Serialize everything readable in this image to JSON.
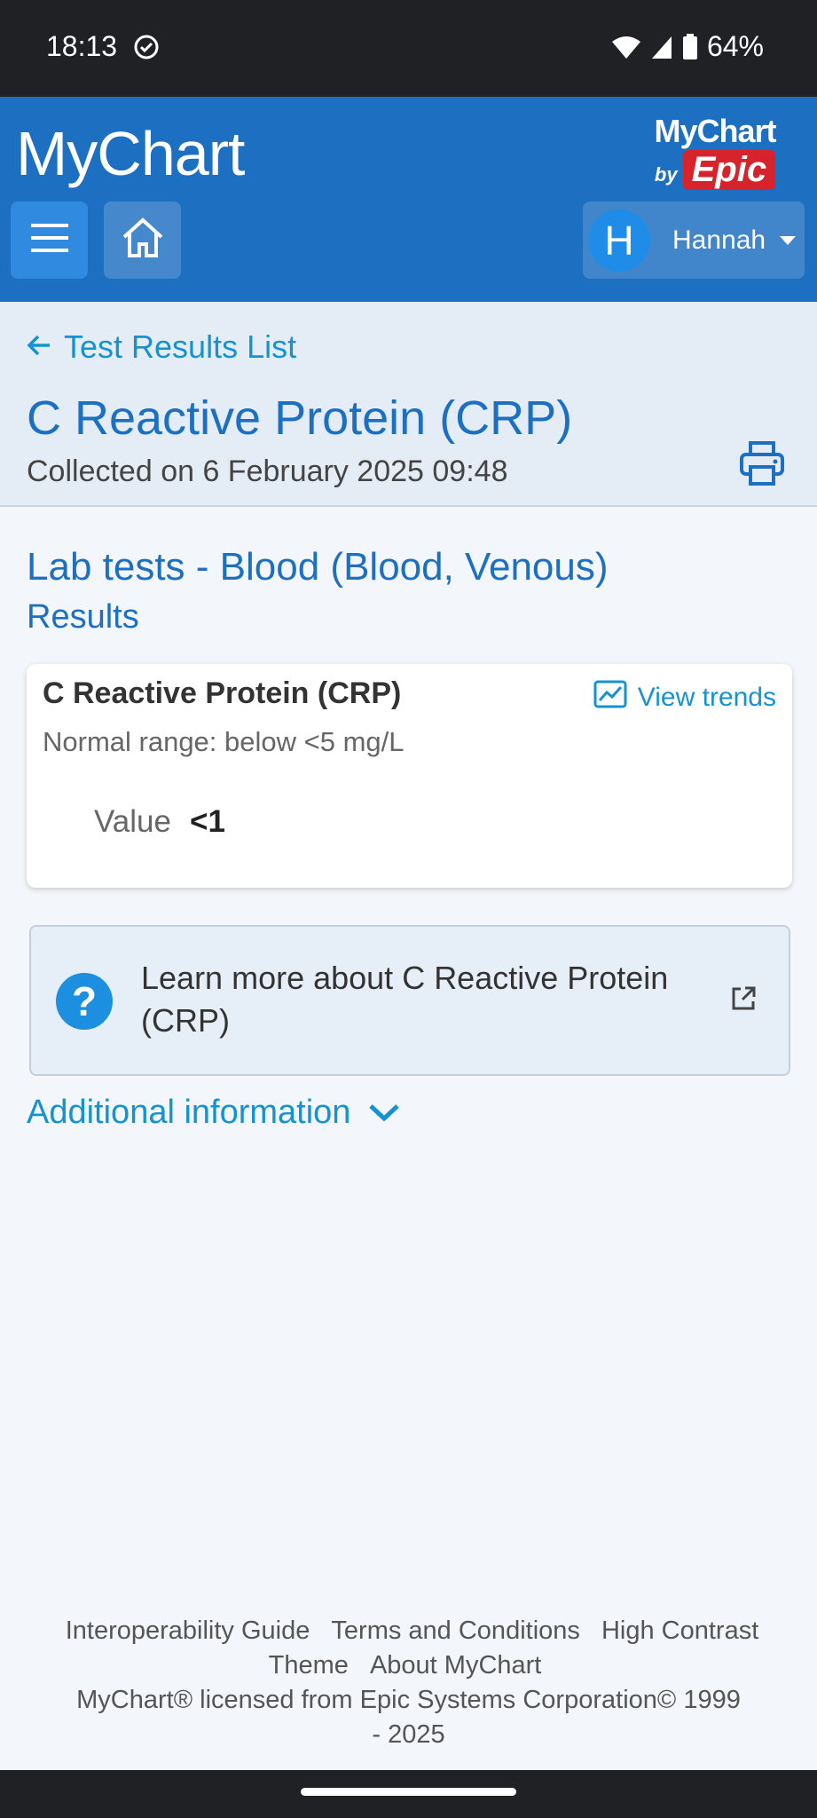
{
  "status_bar": {
    "time": "18:13",
    "battery": "64%",
    "icons": [
      "check-circle-icon",
      "wifi-icon",
      "signal-icon",
      "battery-icon"
    ]
  },
  "header": {
    "logo_text": "MyChart",
    "epic_logo": {
      "line1": "MyChart",
      "by": "by",
      "brand": "Epic"
    },
    "user": {
      "initial": "H",
      "name": "Hannah"
    },
    "colors": {
      "header_bg": "#1d6fc1",
      "accent": "#1593d1"
    }
  },
  "titlebar": {
    "back_label": "Test Results List",
    "title": "C Reactive Protein (CRP)",
    "collected": "Collected on 6 February 2025 09:48"
  },
  "section": {
    "title": "Lab tests - Blood (Blood, Venous)",
    "subtitle": "Results"
  },
  "result": {
    "name": "C Reactive Protein (CRP)",
    "view_trends": "View trends",
    "normal_range": "Normal range: below <5 mg/L",
    "value_label": "Value",
    "value": "<1"
  },
  "learn_more": {
    "text": "Learn more about C Reactive Protein (CRP)"
  },
  "additional": {
    "label": "Additional information"
  },
  "footer": {
    "links": [
      "Interoperability Guide",
      "Terms and Conditions",
      "High Contrast Theme",
      "About MyChart"
    ],
    "copyright": "MyChart® licensed from Epic Systems Corporation© 1999 - 2025"
  }
}
